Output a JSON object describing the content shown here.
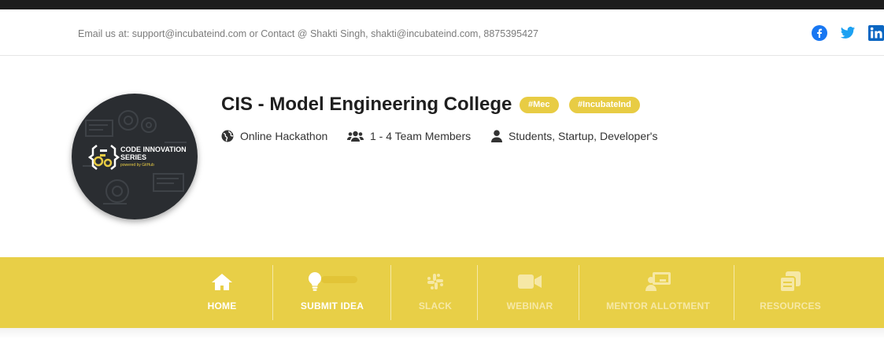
{
  "topbar": {
    "contact_text": "Email us at: support@incubateind.com or Contact @ Shakti Singh, shakti@incubateind.com, 8875395427",
    "social": [
      "facebook-icon",
      "twitter-icon",
      "linkedin-icon"
    ],
    "colors": {
      "facebook": "#1877f2",
      "twitter": "#1da1f2",
      "linkedin": "#0a66c2"
    }
  },
  "profile": {
    "logo": {
      "line1": "CODE INNOVATION",
      "line2": "SERIES",
      "line3": "powered by GitHub"
    },
    "title": "CIS - Model Engineering College",
    "tags": [
      "#Mec",
      "#IncubateInd"
    ],
    "meta": {
      "mode": "Online Hackathon",
      "team_size": "1 - 4 Team Members",
      "audience": "Students, Startup, Developer's"
    }
  },
  "nav": {
    "accent": "#e8cf47",
    "items": [
      {
        "label": "HOME",
        "icon": "home-icon",
        "active": true
      },
      {
        "label": "SUBMIT IDEA",
        "icon": "lightbulb-icon",
        "active": true
      },
      {
        "label": "SLACK",
        "icon": "slack-icon",
        "active": false
      },
      {
        "label": "WEBINAR",
        "icon": "video-camera-icon",
        "active": false
      },
      {
        "label": "MENTOR ALLOTMENT",
        "icon": "presenter-icon",
        "active": false
      },
      {
        "label": "RESOURCES",
        "icon": "copy-icon",
        "active": false
      }
    ]
  }
}
